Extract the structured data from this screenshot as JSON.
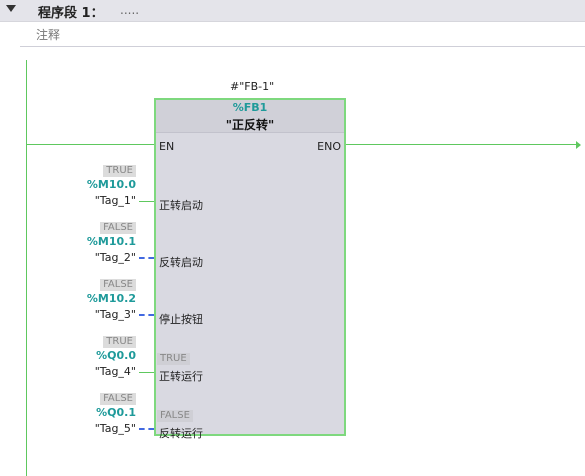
{
  "segment": {
    "title": "程序段 1：",
    "dots": "....."
  },
  "comment": "注释",
  "block": {
    "instance": "#\"FB-1\"",
    "number": "%FB1",
    "name": "\"正反转\"",
    "en": "EN",
    "eno": "ENO"
  },
  "inputs": [
    {
      "value": "TRUE",
      "address": "%M10.0",
      "tag": "\"Tag_1\"",
      "pin": "正转启动"
    },
    {
      "value": "FALSE",
      "address": "%M10.1",
      "tag": "\"Tag_2\"",
      "pin": "反转启动"
    },
    {
      "value": "FALSE",
      "address": "%M10.2",
      "tag": "\"Tag_3\"",
      "pin": "停止按钮"
    },
    {
      "value": "TRUE",
      "address": "%Q0.0",
      "tag": "\"Tag_4\"",
      "pin": "正转运行",
      "pin_value": "TRUE"
    },
    {
      "value": "FALSE",
      "address": "%Q0.1",
      "tag": "\"Tag_5\"",
      "pin": "反转运行",
      "pin_value": "FALSE"
    }
  ],
  "colors": {
    "rail": "#5ec85e",
    "address": "#1e9a9a",
    "false_wire": "#4169e1"
  }
}
